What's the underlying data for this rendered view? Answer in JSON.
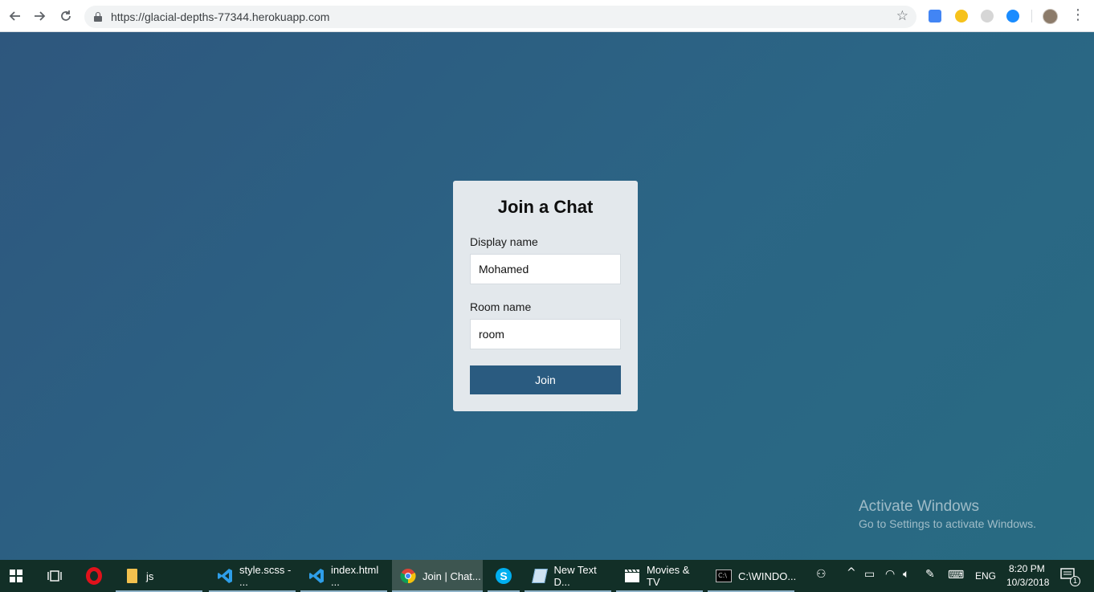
{
  "browser": {
    "url": "https://glacial-depths-77344.herokuapp.com",
    "back_icon": "back-arrow-icon",
    "forward_icon": "forward-arrow-icon",
    "reload_icon": "reload-icon",
    "bookmark_icon": "star-icon",
    "extensions": [
      "translate-icon",
      "moon-icon",
      "grey-extension-icon",
      "blue-extension-icon"
    ],
    "menu_icon": "kebab-menu-icon"
  },
  "join_form": {
    "title": "Join a Chat",
    "display_name_label": "Display name",
    "display_name_value": "Mohamed",
    "room_name_label": "Room name",
    "room_name_value": "room",
    "join_button": "Join"
  },
  "watermark": {
    "title": "Activate Windows",
    "subtitle": "Go to Settings to activate Windows."
  },
  "taskbar": {
    "items": [
      {
        "label": "js",
        "icon": "folder-icon"
      },
      {
        "label": "style.scss - ...",
        "icon": "vscode-icon"
      },
      {
        "label": "index.html ...",
        "icon": "vscode-icon"
      },
      {
        "label": "Join | Chat...",
        "icon": "chrome-icon"
      },
      {
        "label": "",
        "icon": "skype-icon"
      },
      {
        "label": "New Text D...",
        "icon": "notepad-icon"
      },
      {
        "label": "Movies & TV",
        "icon": "movies-icon"
      },
      {
        "label": "C:\\WINDO...",
        "icon": "cmd-icon"
      }
    ],
    "language": "ENG",
    "time": "8:20 PM",
    "date": "10/3/2018",
    "notification_count": "1"
  },
  "colors": {
    "page_bg": "#2b6585",
    "card_bg": "#e3e8ec",
    "button_bg": "#2a5b80",
    "taskbar_bg": "#122f27"
  }
}
